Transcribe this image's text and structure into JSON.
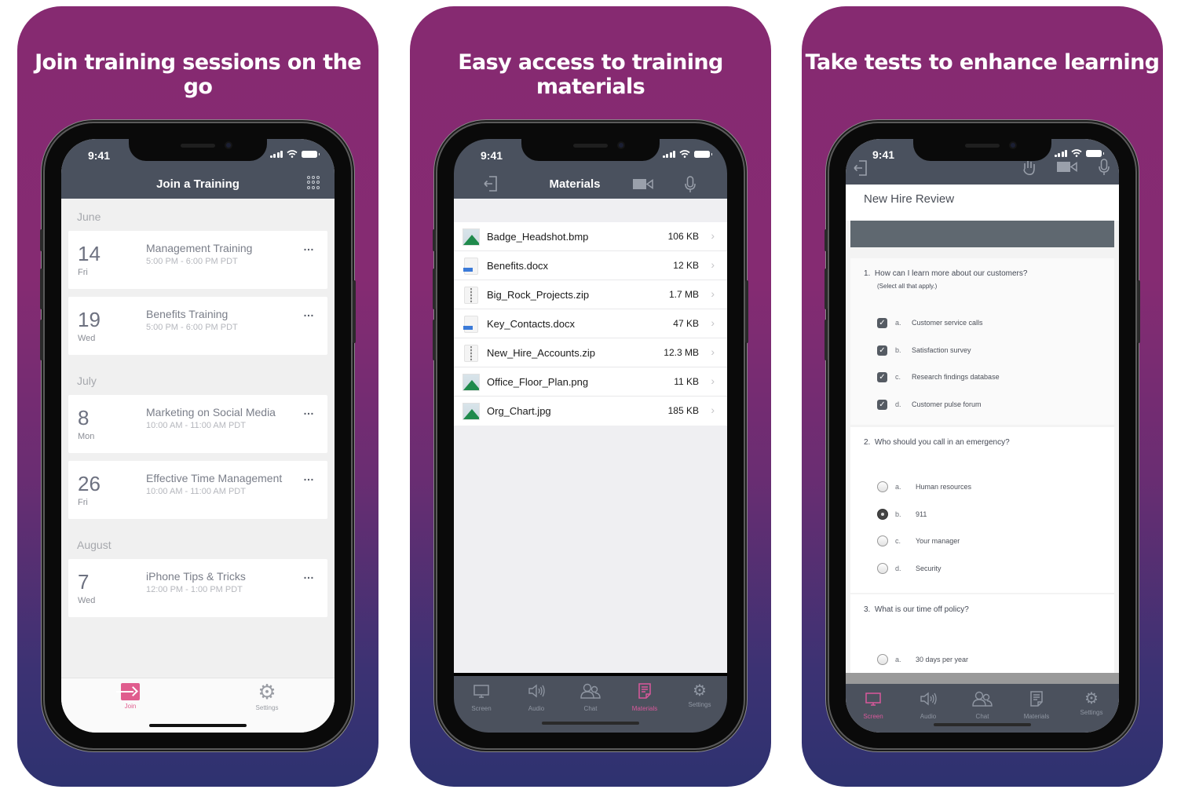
{
  "panels": [
    {
      "headline": "Join training sessions on the go",
      "status_time": "9:41",
      "nav_title": "Join a Training",
      "nav_icon": "grid-icon",
      "months": [
        {
          "label": "June",
          "events": [
            {
              "day": "14",
              "weekday": "Fri",
              "title": "Management Training",
              "time": "5:00 PM - 6:00 PM PDT",
              "more": "…"
            },
            {
              "day": "19",
              "weekday": "Wed",
              "title": "Benefits Training",
              "time": "5:00 PM - 6:00 PM PDT",
              "more": "…"
            }
          ]
        },
        {
          "label": "July",
          "events": [
            {
              "day": "8",
              "weekday": "Mon",
              "title": "Marketing on Social Media",
              "time": "10:00 AM - 11:00 AM PDT",
              "more": "…"
            },
            {
              "day": "26",
              "weekday": "Fri",
              "title": "Effective Time Management",
              "time": "10:00 AM - 11:00 AM PDT",
              "more": "…"
            }
          ]
        },
        {
          "label": "August",
          "events": [
            {
              "day": "7",
              "weekday": "Wed",
              "title": "iPhone Tips & Tricks",
              "time": "12:00 PM - 1:00 PM PDT",
              "more": "…"
            }
          ]
        }
      ],
      "tabs": [
        {
          "label": "Join",
          "icon": "join-icon",
          "active": true
        },
        {
          "label": "Settings",
          "icon": "gear-icon",
          "active": false
        }
      ]
    },
    {
      "headline": "Easy access to training materials",
      "status_time": "9:41",
      "nav_title": "Materials",
      "files": [
        {
          "name": "Badge_Headshot.bmp",
          "size": "106 KB",
          "type": "image"
        },
        {
          "name": "Benefits.docx",
          "size": "12 KB",
          "type": "doc"
        },
        {
          "name": "Big_Rock_Projects.zip",
          "size": "1.7 MB",
          "type": "zip"
        },
        {
          "name": "Key_Contacts.docx",
          "size": "47 KB",
          "type": "doc"
        },
        {
          "name": "New_Hire_Accounts.zip",
          "size": "12.3 MB",
          "type": "zip"
        },
        {
          "name": "Office_Floor_Plan.png",
          "size": "11 KB",
          "type": "image"
        },
        {
          "name": "Org_Chart.jpg",
          "size": "185 KB",
          "type": "image"
        }
      ],
      "chevron": "›",
      "tabs": [
        {
          "label": "Screen",
          "icon": "monitor-icon",
          "glyph": "▭"
        },
        {
          "label": "Audio",
          "icon": "speaker-icon",
          "glyph": "🔈"
        },
        {
          "label": "Chat",
          "icon": "people-icon",
          "glyph": "☺"
        },
        {
          "label": "Materials",
          "icon": "document-icon",
          "glyph": "☷"
        },
        {
          "label": "Settings",
          "icon": "gear-icon",
          "glyph": "⚙"
        }
      ],
      "active_tab": "Materials"
    },
    {
      "headline": "Take tests to enhance learning",
      "status_time": "9:41",
      "quiz_title": "New Hire Review",
      "questions": [
        {
          "number": "1.",
          "text": "How can I learn more about our customers?",
          "hint": "(Select all that apply.)",
          "type": "checkbox",
          "options": [
            {
              "letter": "a.",
              "text": "Customer service calls",
              "checked": true
            },
            {
              "letter": "b.",
              "text": "Satisfaction survey",
              "checked": true
            },
            {
              "letter": "c.",
              "text": "Research findings database",
              "checked": true
            },
            {
              "letter": "d.",
              "text": "Customer pulse forum",
              "checked": true
            }
          ]
        },
        {
          "number": "2.",
          "text": "Who should you call in an emergency?",
          "type": "radio",
          "options": [
            {
              "letter": "a.",
              "text": "Human resources",
              "checked": false
            },
            {
              "letter": "b.",
              "text": "911",
              "checked": true
            },
            {
              "letter": "c.",
              "text": "Your manager",
              "checked": false
            },
            {
              "letter": "d.",
              "text": "Security",
              "checked": false
            }
          ]
        },
        {
          "number": "3.",
          "text": "What is our time off policy?",
          "type": "radio",
          "options": [
            {
              "letter": "a.",
              "text": "30 days per year",
              "checked": false
            }
          ]
        }
      ],
      "tabs": [
        {
          "label": "Screen",
          "icon": "monitor-icon",
          "glyph": "▭"
        },
        {
          "label": "Audio",
          "icon": "speaker-icon",
          "glyph": "🔈"
        },
        {
          "label": "Chat",
          "icon": "people-icon",
          "glyph": "☺"
        },
        {
          "label": "Materials",
          "icon": "document-icon",
          "glyph": "☷"
        },
        {
          "label": "Settings",
          "icon": "gear-icon",
          "glyph": "⚙"
        }
      ],
      "active_tab": "Screen"
    }
  ],
  "colors": {
    "accent": "#d9599b",
    "join_accent": "#e05d8e",
    "nav_bg": "#4a515e",
    "background_top": "#862a71",
    "background_bottom": "#2e3270"
  }
}
